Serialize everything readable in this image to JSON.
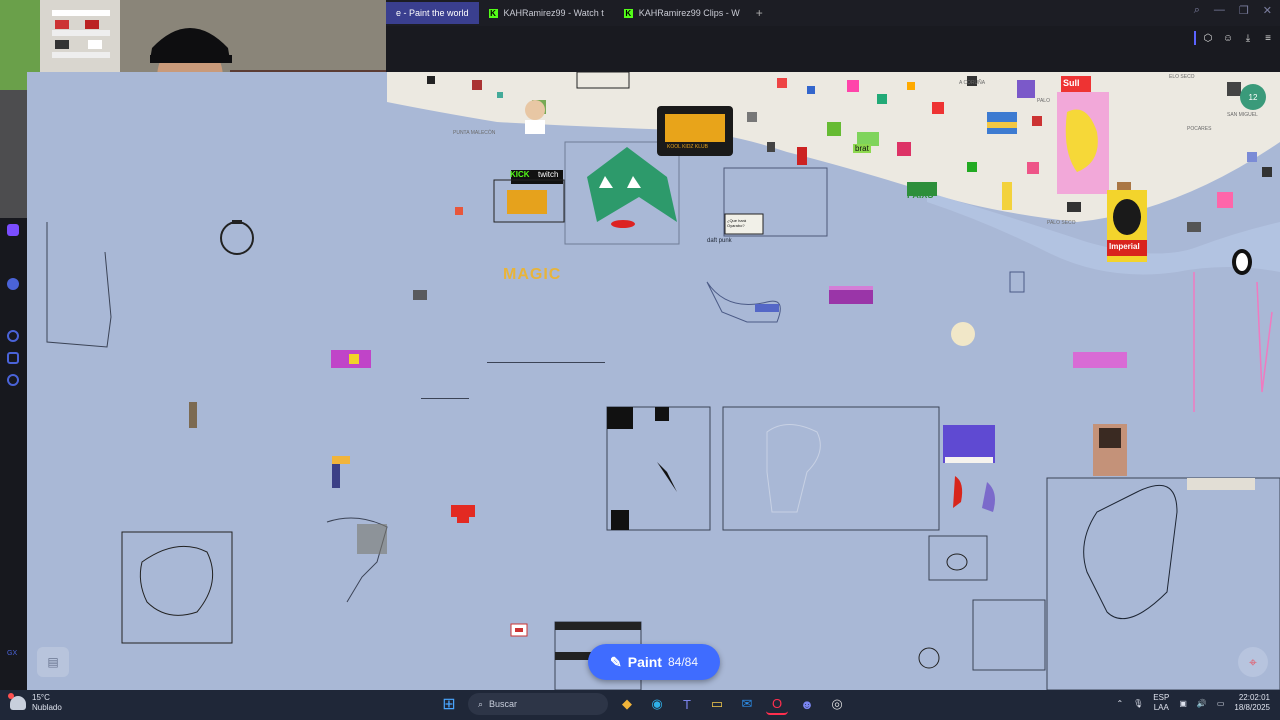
{
  "browser": {
    "tabs": [
      {
        "label": "e - Paint the world",
        "active": true,
        "icon": "wplace-icon"
      },
      {
        "label": "KAHRamirez99 - Watch t",
        "active": false,
        "icon": "kick-icon"
      },
      {
        "label": "KAHRamirez99 Clips - W",
        "active": false,
        "icon": "kick-icon"
      }
    ],
    "new_tab_glyph": "+",
    "accent": "#3a3f8f"
  },
  "canvas": {
    "stickers": {
      "kick": "KICK",
      "twitch": "twitch",
      "magic": "MAGIC",
      "sull": "Sull",
      "imperial": "Imperial",
      "kool_kidz": "KOOL KIDZ KLUB",
      "brat": "brat",
      "sign": "¿Que hará Oyarabo?",
      "sign_under": "daft punk",
      "map_labels": [
        "PUNTA MALECÓN",
        "PALO",
        "PALO SECO",
        "POCARES",
        "SAN MIGUEL",
        "A CORUÑA",
        "ELO SECO",
        "PAIXS"
      ]
    },
    "badge_count": "12",
    "background": "#a9b8d6"
  },
  "paint_button": {
    "label": "Paint",
    "count": "84/84"
  },
  "taskbar": {
    "weather_temp": "15°C",
    "weather_desc": "Nublado",
    "search_placeholder": "Buscar",
    "lang_top": "ESP",
    "lang_bottom": "LAA",
    "time": "22:02:01",
    "date": "18/8/2025"
  }
}
